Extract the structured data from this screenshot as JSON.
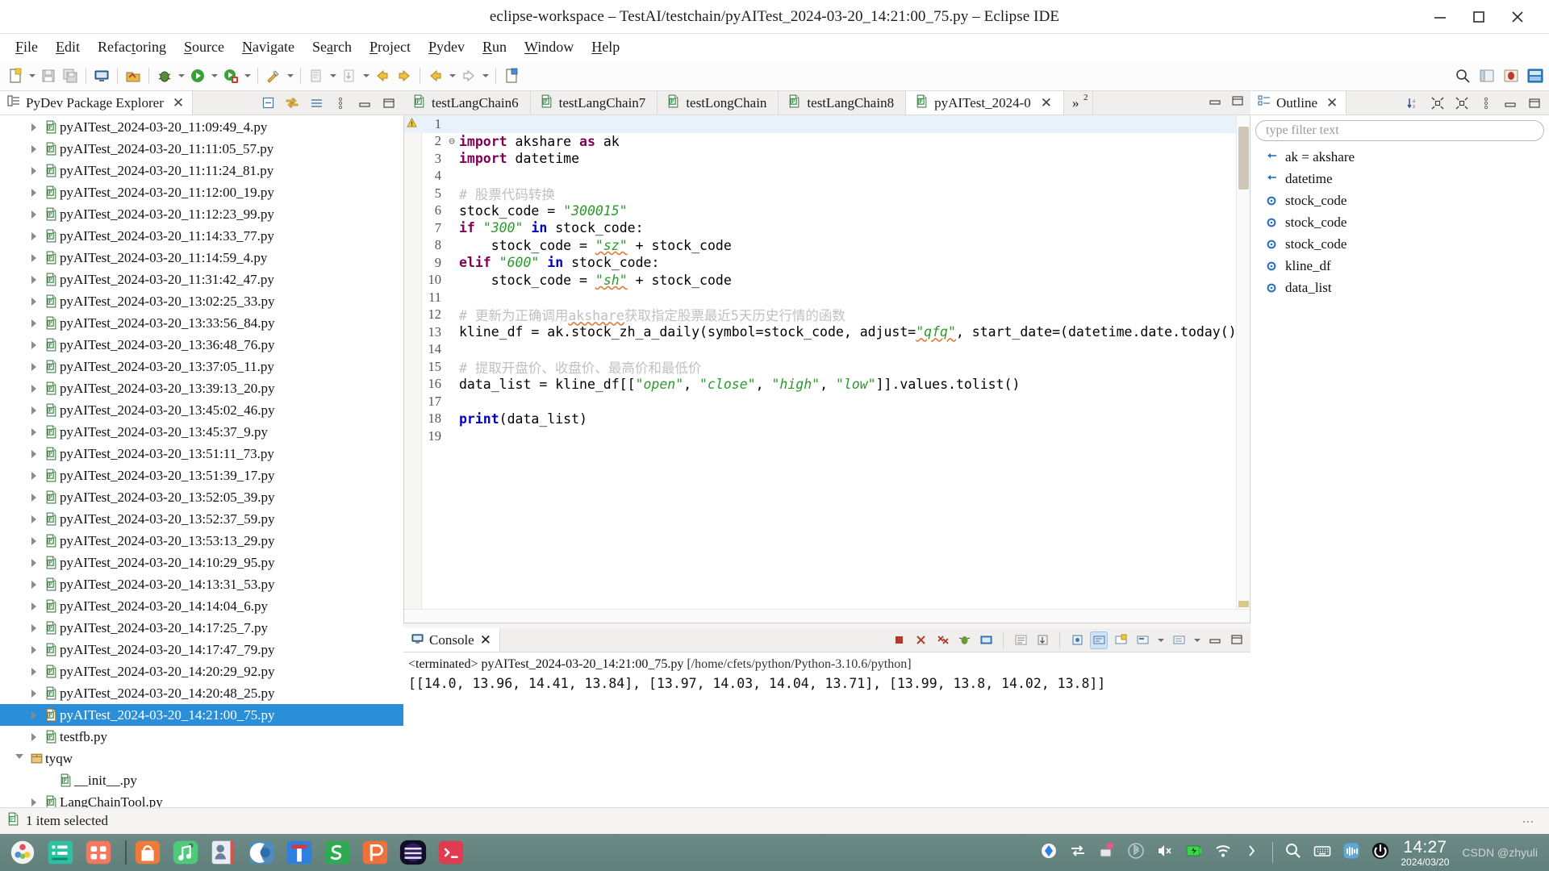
{
  "window": {
    "title": "eclipse-workspace  –  TestAI/testchain/pyAITest_2024-03-20_14:21:00_75.py  –  Eclipse IDE",
    "minimize_label": "—",
    "maximize_label": "□",
    "close_label": "✕"
  },
  "menubar": {
    "items": [
      {
        "label": "File"
      },
      {
        "label": "Edit"
      },
      {
        "label": "Refactoring"
      },
      {
        "label": "Source"
      },
      {
        "label": "Navigate"
      },
      {
        "label": "Search"
      },
      {
        "label": "Project"
      },
      {
        "label": "Pydev"
      },
      {
        "label": "Run"
      },
      {
        "label": "Window"
      },
      {
        "label": "Help"
      }
    ]
  },
  "toolbar": {
    "items": [
      "new-file-icon",
      "dropdown-caret",
      "save-icon",
      "save-all-icon",
      "sep",
      "console-icon",
      "sep",
      "export-icon",
      "sep",
      "debug-icon",
      "dropdown-caret",
      "run-icon",
      "dropdown-caret",
      "coverage-icon",
      "dropdown-caret",
      "sep",
      "external-tools-icon",
      "dropdown-caret",
      "sep",
      "skip-breakpoints-icon",
      "dropdown-caret",
      "next-annotation-icon",
      "dropdown-caret",
      "back-icon",
      "forward-icon",
      "sep",
      "previous-edit-icon",
      "dropdown-caret",
      "next-edit-icon",
      "dropdown-caret",
      "sep",
      "new-pydev-project-icon"
    ],
    "right_items": [
      "search-icon",
      "perspective-java-icon",
      "perspective-debug-icon",
      "perspective-pydev-icon"
    ]
  },
  "explorer": {
    "tab_title": "PyDev Package Explorer",
    "tab_close": "✕",
    "tools": [
      "collapse-all-icon",
      "link-with-editor-icon",
      "view-menu-icon",
      "minimize-icon",
      "maximize-icon"
    ],
    "items": [
      {
        "label": "pyAITest_2024-03-20_11:09:49_4.py",
        "type": "py",
        "indent": 1,
        "arrow": "right"
      },
      {
        "label": "pyAITest_2024-03-20_11:11:05_57.py",
        "type": "py",
        "indent": 1,
        "arrow": "right"
      },
      {
        "label": "pyAITest_2024-03-20_11:11:24_81.py",
        "type": "py",
        "indent": 1,
        "arrow": "right"
      },
      {
        "label": "pyAITest_2024-03-20_11:12:00_19.py",
        "type": "py",
        "indent": 1,
        "arrow": "right"
      },
      {
        "label": "pyAITest_2024-03-20_11:12:23_99.py",
        "type": "py",
        "indent": 1,
        "arrow": "right"
      },
      {
        "label": "pyAITest_2024-03-20_11:14:33_77.py",
        "type": "py",
        "indent": 1,
        "arrow": "right"
      },
      {
        "label": "pyAITest_2024-03-20_11:14:59_4.py",
        "type": "py",
        "indent": 1,
        "arrow": "right"
      },
      {
        "label": "pyAITest_2024-03-20_11:31:42_47.py",
        "type": "py",
        "indent": 1,
        "arrow": "right"
      },
      {
        "label": "pyAITest_2024-03-20_13:02:25_33.py",
        "type": "py",
        "indent": 1,
        "arrow": "right"
      },
      {
        "label": "pyAITest_2024-03-20_13:33:56_84.py",
        "type": "py",
        "indent": 1,
        "arrow": "right"
      },
      {
        "label": "pyAITest_2024-03-20_13:36:48_76.py",
        "type": "py",
        "indent": 1,
        "arrow": "right"
      },
      {
        "label": "pyAITest_2024-03-20_13:37:05_11.py",
        "type": "py",
        "indent": 1,
        "arrow": "right"
      },
      {
        "label": "pyAITest_2024-03-20_13:39:13_20.py",
        "type": "py",
        "indent": 1,
        "arrow": "right"
      },
      {
        "label": "pyAITest_2024-03-20_13:45:02_46.py",
        "type": "py",
        "indent": 1,
        "arrow": "right"
      },
      {
        "label": "pyAITest_2024-03-20_13:45:37_9.py",
        "type": "py",
        "indent": 1,
        "arrow": "right"
      },
      {
        "label": "pyAITest_2024-03-20_13:51:11_73.py",
        "type": "py",
        "indent": 1,
        "arrow": "right"
      },
      {
        "label": "pyAITest_2024-03-20_13:51:39_17.py",
        "type": "py",
        "indent": 1,
        "arrow": "right"
      },
      {
        "label": "pyAITest_2024-03-20_13:52:05_39.py",
        "type": "py",
        "indent": 1,
        "arrow": "right"
      },
      {
        "label": "pyAITest_2024-03-20_13:52:37_59.py",
        "type": "py",
        "indent": 1,
        "arrow": "right"
      },
      {
        "label": "pyAITest_2024-03-20_13:53:13_29.py",
        "type": "py",
        "indent": 1,
        "arrow": "right"
      },
      {
        "label": "pyAITest_2024-03-20_14:10:29_95.py",
        "type": "py",
        "indent": 1,
        "arrow": "right"
      },
      {
        "label": "pyAITest_2024-03-20_14:13:31_53.py",
        "type": "py",
        "indent": 1,
        "arrow": "right"
      },
      {
        "label": "pyAITest_2024-03-20_14:14:04_6.py",
        "type": "py",
        "indent": 1,
        "arrow": "right"
      },
      {
        "label": "pyAITest_2024-03-20_14:17:25_7.py",
        "type": "py",
        "indent": 1,
        "arrow": "right"
      },
      {
        "label": "pyAITest_2024-03-20_14:17:47_79.py",
        "type": "py",
        "indent": 1,
        "arrow": "right"
      },
      {
        "label": "pyAITest_2024-03-20_14:20:29_92.py",
        "type": "py",
        "indent": 1,
        "arrow": "right"
      },
      {
        "label": "pyAITest_2024-03-20_14:20:48_25.py",
        "type": "py",
        "indent": 1,
        "arrow": "right"
      },
      {
        "label": "pyAITest_2024-03-20_14:21:00_75.py",
        "type": "py-open",
        "indent": 1,
        "arrow": "right",
        "selected": true
      },
      {
        "label": "testfb.py",
        "type": "py",
        "indent": 1,
        "arrow": "right"
      },
      {
        "label": "tyqw",
        "type": "package",
        "indent": 0,
        "arrow": "down"
      },
      {
        "label": "__init__.py",
        "type": "py",
        "indent": 2,
        "arrow": "none"
      },
      {
        "label": "LangChainTool.py",
        "type": "py",
        "indent": 1,
        "arrow": "right"
      }
    ]
  },
  "editor": {
    "tabs": [
      {
        "label": "testLangChain6",
        "active": false,
        "closable": false
      },
      {
        "label": "testLangChain7",
        "active": false,
        "closable": false
      },
      {
        "label": "testLongChain",
        "active": false,
        "closable": false
      },
      {
        "label": "testLangChain8",
        "active": false,
        "closable": false
      },
      {
        "label": "pyAITest_2024-0",
        "active": true,
        "closable": true,
        "close": "✕"
      }
    ],
    "more_tabs_indicator": "»",
    "more_tabs_count": "2",
    "tools": [
      "minimize-icon",
      "maximize-icon"
    ],
    "lines": [
      {
        "n": "1",
        "fold": "",
        "highlight": true,
        "warning": true,
        "tokens": []
      },
      {
        "n": "2",
        "fold": "⊖",
        "tokens": [
          {
            "t": "import",
            "c": "k"
          },
          {
            "t": " akshare ",
            "c": "n"
          },
          {
            "t": "as",
            "c": "k"
          },
          {
            "t": " ak",
            "c": "n"
          }
        ]
      },
      {
        "n": "3",
        "fold": "",
        "tokens": [
          {
            "t": "import",
            "c": "k"
          },
          {
            "t": " datetime",
            "c": "n"
          }
        ]
      },
      {
        "n": "4",
        "fold": "",
        "tokens": []
      },
      {
        "n": "5",
        "fold": "",
        "tokens": [
          {
            "t": "# 股票代码转换",
            "c": "c"
          }
        ]
      },
      {
        "n": "6",
        "fold": "",
        "tokens": [
          {
            "t": "stock_code = ",
            "c": "n"
          },
          {
            "t": "\"300015\"",
            "c": "s"
          }
        ]
      },
      {
        "n": "7",
        "fold": "",
        "tokens": [
          {
            "t": "if",
            "c": "k"
          },
          {
            "t": " ",
            "c": "n"
          },
          {
            "t": "\"300\"",
            "c": "s"
          },
          {
            "t": " ",
            "c": "n"
          },
          {
            "t": "in",
            "c": "kb"
          },
          {
            "t": " stock_code:",
            "c": "n"
          }
        ]
      },
      {
        "n": "8",
        "fold": "",
        "tokens": [
          {
            "t": "    stock_code = ",
            "c": "n"
          },
          {
            "t": "\"sz\"",
            "c": "s sq"
          },
          {
            "t": " + stock_code",
            "c": "n"
          }
        ]
      },
      {
        "n": "9",
        "fold": "",
        "tokens": [
          {
            "t": "elif",
            "c": "k"
          },
          {
            "t": " ",
            "c": "n"
          },
          {
            "t": "\"600\"",
            "c": "s"
          },
          {
            "t": " ",
            "c": "n"
          },
          {
            "t": "in",
            "c": "kb"
          },
          {
            "t": " stock_code:",
            "c": "n"
          }
        ]
      },
      {
        "n": "10",
        "fold": "",
        "tokens": [
          {
            "t": "    stock_code = ",
            "c": "n"
          },
          {
            "t": "\"sh\"",
            "c": "s sq"
          },
          {
            "t": " + stock_code",
            "c": "n"
          }
        ]
      },
      {
        "n": "11",
        "fold": "",
        "tokens": []
      },
      {
        "n": "12",
        "fold": "",
        "tokens": [
          {
            "t": "# 更新为正确调用",
            "c": "c"
          },
          {
            "t": "akshare",
            "c": "c sq"
          },
          {
            "t": "获取指定股票最近5天历史行情的函数",
            "c": "c"
          }
        ]
      },
      {
        "n": "13",
        "fold": "",
        "tokens": [
          {
            "t": "kline_df = ak.stock_zh_a_daily(symbol=stock_code, adjust=",
            "c": "n"
          },
          {
            "t": "\"qfq\"",
            "c": "s sq"
          },
          {
            "t": ", start_date=(datetime.date.today() -",
            "c": "n"
          }
        ]
      },
      {
        "n": "14",
        "fold": "",
        "tokens": []
      },
      {
        "n": "15",
        "fold": "",
        "tokens": [
          {
            "t": "# 提取开盘价、收盘价、最高价和最低价",
            "c": "c"
          }
        ]
      },
      {
        "n": "16",
        "fold": "",
        "tokens": [
          {
            "t": "data_list = kline_df[[",
            "c": "n"
          },
          {
            "t": "\"open\"",
            "c": "s"
          },
          {
            "t": ", ",
            "c": "n"
          },
          {
            "t": "\"close\"",
            "c": "s"
          },
          {
            "t": ", ",
            "c": "n"
          },
          {
            "t": "\"high\"",
            "c": "s"
          },
          {
            "t": ", ",
            "c": "n"
          },
          {
            "t": "\"low\"",
            "c": "s"
          },
          {
            "t": "]].values.tolist()",
            "c": "n"
          }
        ]
      },
      {
        "n": "17",
        "fold": "",
        "tokens": []
      },
      {
        "n": "18",
        "fold": "",
        "tokens": [
          {
            "t": "print",
            "c": "kb"
          },
          {
            "t": "(data_list)",
            "c": "n"
          }
        ]
      },
      {
        "n": "19",
        "fold": "",
        "tokens": []
      }
    ]
  },
  "console": {
    "tab_title": "Console",
    "tab_close": "✕",
    "tools": [
      "terminate-icon",
      "remove-launch-icon",
      "remove-all-icon",
      "debug-console-icon",
      "open-console-icon",
      "sep",
      "word-wrap-icon",
      "scroll-lock-icon",
      "sep",
      "pin-console-icon",
      "show-console-icon",
      "new-console-view-icon",
      "display-selected-icon",
      "dropdown-caret",
      "open-console-menu-icon",
      "dropdown-caret",
      "minimize-icon",
      "maximize-icon"
    ],
    "status_prefix": "<terminated>",
    "status_file": "pyAITest_2024-03-20_14:21:00_75.py",
    "status_interpreter": "[/home/cfets/python/Python-3.10.6/python]",
    "output": "[[14.0, 13.96, 14.41, 13.84], [13.97, 14.03, 14.04, 13.71], [13.99, 13.8, 14.02, 13.8]]"
  },
  "outline": {
    "tab_title": "Outline",
    "tab_close": "✕",
    "tools": [
      "sort-az-icon",
      "collapse-all-icon",
      "expand-all-icon",
      "view-menu-icon",
      "minimize-icon",
      "maximize-icon"
    ],
    "filter_placeholder": "type filter text",
    "filter_value": "",
    "items": [
      {
        "label": "ak = akshare",
        "kind": "import"
      },
      {
        "label": "datetime",
        "kind": "import"
      },
      {
        "label": "stock_code",
        "kind": "attr"
      },
      {
        "label": "stock_code",
        "kind": "attr"
      },
      {
        "label": "stock_code",
        "kind": "attr"
      },
      {
        "label": "kline_df",
        "kind": "attr"
      },
      {
        "label": "data_list",
        "kind": "attr"
      }
    ]
  },
  "statusbar": {
    "icon": "py-file-icon",
    "text": "1 item selected"
  },
  "taskbar": {
    "apps": [
      {
        "name": "app-launcher",
        "color": "#f0f0f0"
      },
      {
        "name": "files-manager",
        "color": "#2cc1a0"
      },
      {
        "name": "app-grid",
        "color": "#f5775e"
      },
      {
        "name": "app-store",
        "color": "#f07a37"
      },
      {
        "name": "music-player",
        "color": "#4ecb7a"
      },
      {
        "name": "contacts",
        "color": "#d5d9e2"
      },
      {
        "name": "browser",
        "color": "#5a9fd4"
      },
      {
        "name": "wps-writer",
        "color": "#2f7fe0"
      },
      {
        "name": "wps-spreadsheet",
        "color": "#2eaa52"
      },
      {
        "name": "wps-presentation",
        "color": "#f0703a"
      },
      {
        "name": "eclipse-ide",
        "color": "#120c24"
      },
      {
        "name": "terminal",
        "color": "#e03b4e"
      }
    ],
    "tray": [
      "app-indicator-icon",
      "network-transfer-icon",
      "input-method-icon",
      "bluetooth-icon",
      "volume-muted-icon",
      "battery-charging-icon",
      "wifi-icon",
      "tray-expand-icon"
    ],
    "tray2": [
      "search-icon",
      "keyboard-icon",
      "sound-mixer-icon",
      "power-icon"
    ],
    "clock_time": "14:27",
    "clock_date": "2024/03/20",
    "watermark": "CSDN @zhyuli"
  }
}
